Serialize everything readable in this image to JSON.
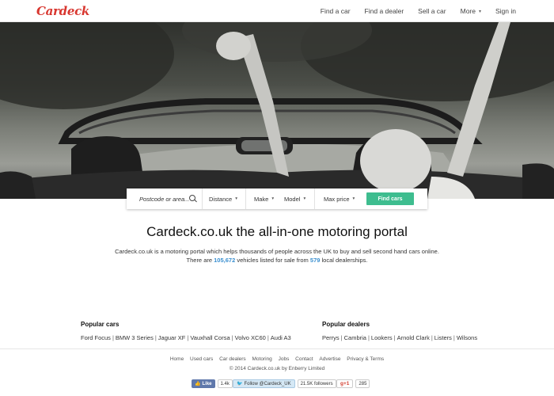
{
  "header": {
    "logo": "Cardeck",
    "nav": [
      {
        "label": "Find a car"
      },
      {
        "label": "Find a dealer"
      },
      {
        "label": "Sell a car"
      },
      {
        "label": "More",
        "caret": "▾"
      },
      {
        "label": "Sign in"
      }
    ]
  },
  "search": {
    "postcode_placeholder": "Postcode or area...",
    "distance": "Distance",
    "make": "Make",
    "model": "Model",
    "max_price": "Max price",
    "button": "Find cars",
    "caret": "▾"
  },
  "main": {
    "title": "Cardeck.co.uk the all-in-one motoring portal",
    "line1": "Cardeck.co.uk is a motoring portal which helps thousands of people across the UK to buy and sell second hand cars online.",
    "line2_prefix": "There are",
    "vehicles_count": "105,672",
    "line2_mid": "vehicles listed for sale from",
    "dealers_count": "579",
    "line2_suffix": "local dealerships."
  },
  "popular_cars": {
    "heading": "Popular cars",
    "items": [
      "Ford Focus",
      "BMW 3 Series",
      "Jaguar XF",
      "Vauxhall Corsa",
      "Volvo XC60",
      "Audi A3"
    ]
  },
  "popular_dealers": {
    "heading": "Popular dealers",
    "items": [
      "Perrys",
      "Cambria",
      "Lookers",
      "Arnold Clark",
      "Listers",
      "Wilsons"
    ]
  },
  "footer": {
    "links": [
      "Home",
      "Used cars",
      "Car dealers",
      "Motoring",
      "Jobs",
      "Contact",
      "Advertise",
      "Privacy & Terms"
    ],
    "copyright": "© 2014 Cardeck.co.uk by Enberry Limited",
    "like": "Like",
    "like_count": "1.4k",
    "follow": "Follow @Cardeck_UK",
    "followers": "21.5K followers",
    "gplus": "g+1",
    "gplus_count": "285"
  },
  "colors": {
    "brand": "#d8362f",
    "accent_button": "#3ebd8f",
    "link_blue": "#3a8fd0"
  }
}
